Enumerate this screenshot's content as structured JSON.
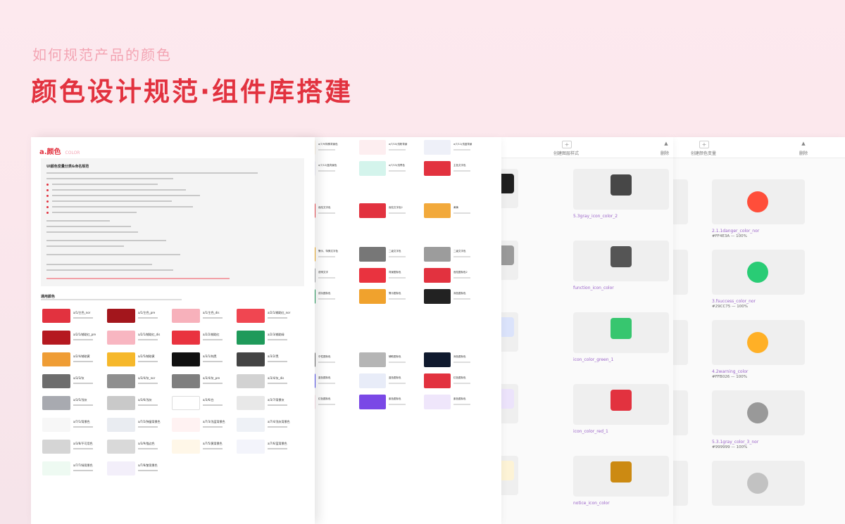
{
  "hero": {
    "subtitle": "如何规范产品的颜色",
    "title": "颜色设计规范·组件库搭建"
  },
  "doc": {
    "section_name": "a.颜色",
    "section_en": "COLOR",
    "guide_title": "UI颜色变量分类&命名规范",
    "palette_title": "通用颜色",
    "swatches": [
      {
        "label": "a/1/主色_nor",
        "sub": "primary_color_nor",
        "color": "#e2323f"
      },
      {
        "label": "a/1/主色_pre",
        "sub": "primary_color_pre",
        "color": "#a3161c"
      },
      {
        "label": "a/1/主色_dis",
        "sub": "primary_color_dis",
        "color": "#f7b1bb"
      },
      {
        "label": "a/2/1/辅助红_nor",
        "sub": "danger_color_nor",
        "color": "#f04651"
      },
      {
        "label": "a/2/1/辅助红_pre",
        "sub": "danger_color_pre",
        "color": "#b51920"
      },
      {
        "label": "a/2/1/辅助红_dis",
        "sub": "danger_color_dis",
        "color": "#f8b6c1"
      },
      {
        "label": "a/2/2/辅助红",
        "sub": "danger_color_2",
        "color": "#e9333f"
      },
      {
        "label": "a/2/3/辅助绿",
        "sub": "success_color",
        "color": "#1f9a5a"
      },
      {
        "label": "a/2/4/辅助黄",
        "sub": "warning_color",
        "color": "#ef9d35"
      },
      {
        "label": "a/2/5/辅助黄",
        "sub": "warning_color_2",
        "color": "#f6b82b"
      },
      {
        "label": "a/3/1/纯黑",
        "sub": "black_color",
        "color": "#111111"
      },
      {
        "label": "a/3/2/黑",
        "sub": "gray_color",
        "color": "#444444"
      },
      {
        "label": "a/3/3/灰",
        "sub": "gray_color_2",
        "color": "#6d6d6d"
      },
      {
        "label": "a/3/4/灰_nor",
        "sub": "gray_color_3_nor",
        "color": "#8f8f8f"
      },
      {
        "label": "a/3/4/灰_pre",
        "sub": "gray_color_3_pre",
        "color": "#7f7f7f"
      },
      {
        "label": "a/3/4/灰_dis",
        "sub": "gray_color_3_dis",
        "color": "#d2d2d2"
      },
      {
        "label": "a/3/5/浅灰",
        "sub": "gray_color_4",
        "color": "#a8aab0"
      },
      {
        "label": "a/3/6/浅灰",
        "sub": "gray_color_5",
        "color": "#c9c9c9"
      },
      {
        "label": "a/3/6/白",
        "sub": "white_color",
        "color": "#ffffff"
      },
      {
        "label": "a/3/7/背景灰",
        "sub": "line_color",
        "color": "#e8e8e8"
      },
      {
        "label": "a/7/1/背景色",
        "sub": "body_color",
        "color": "#f7f7f7"
      },
      {
        "label": "a/7/2/弹窗背景色",
        "sub": "body_color_2",
        "color": "#e9ecf1"
      },
      {
        "label": "a/7/3/浅蓝背景色",
        "sub": "body_color_3",
        "color": "#fff2f2"
      },
      {
        "label": "a/7/4/浅灰背景色",
        "sub": "body_color_4",
        "color": "#eef1f6"
      },
      {
        "label": "a/3/8/不可用色",
        "sub": "disable_color",
        "color": "#d5d5d5"
      },
      {
        "label": "a/3/9/描边色",
        "sub": "border_color",
        "color": "#d9d9d9"
      },
      {
        "label": "a/7/5/黄背景色",
        "sub": "body_color_5",
        "color": "#fff7e8"
      },
      {
        "label": "a/7/6/蓝背景色",
        "sub": "body_color_6",
        "color": "#f3f4fb"
      },
      {
        "label": "a/7/7/绿背景色",
        "sub": "body_color_7",
        "color": "#eefaf2"
      },
      {
        "label": "a/7/8/紫背景色",
        "sub": "body_color_8",
        "color": "#f3effa"
      }
    ]
  },
  "doc2": {
    "swatches": [
      {
        "label": "a/7/9/特殊背景色",
        "sub": "body_color_2",
        "color": "#fdf6e7"
      },
      {
        "label": "a/7/10/浅粉背景",
        "sub": "body_color_3",
        "color": "#fdeef0"
      },
      {
        "label": "a/7/11/浅蓝背景",
        "sub": "body_color_4",
        "color": "#eef0f8"
      },
      {
        "label": "a/7/12/蓝背景色",
        "sub": "body_color_5",
        "color": "#f1f1fb"
      },
      {
        "label": "a/7/15/浅青色",
        "sub": "bubble_color_3",
        "color": "#d4f4ec"
      },
      {
        "label": "主色文字色",
        "sub": "primary_text",
        "color": "#e2323f"
      },
      {
        "label": "危险文字色",
        "sub": "danger_text",
        "color": "#ee4a50"
      },
      {
        "label": "危险文字色2",
        "sub": "danger_text_2",
        "color": "#e2323f"
      },
      {
        "label": "黄黄",
        "sub": "warning_text",
        "color": "#f2a93b"
      },
      {
        "label": "警示、特殊文字色",
        "sub": "warning_text_2",
        "color": "#f4ae26"
      },
      {
        "label": "二级文字色",
        "sub": "gray_text",
        "color": "#777777"
      },
      {
        "label": "二级文字色",
        "sub": "gray_text_2",
        "color": "#9c9c9c"
      },
      {
        "label": "说明文字",
        "sub": "gray_text_3",
        "color": "#a6a9ae"
      },
      {
        "label": "背景图标色",
        "sub": "danger_icon",
        "color": "#e9333f"
      },
      {
        "label": "危险图标色2",
        "sub": "danger_icon_2",
        "color": "#e2323f"
      },
      {
        "label": "成功图标色",
        "sub": "success_icon",
        "color": "#1f9a5a"
      },
      {
        "label": "警示图标色",
        "sub": "warning_icon",
        "color": "#f0a22d"
      },
      {
        "label": "深色图标色",
        "sub": "black_icon",
        "color": "#222222"
      },
      {
        "label": "中性图标色",
        "sub": "gray_icon",
        "color": "#6b6b6b"
      },
      {
        "label": "辅助图标色",
        "sub": "gray_icon_2",
        "color": "#b5b5b5"
      },
      {
        "label": "深色图标色",
        "sub": "navy_icon",
        "color": "#101a2e"
      },
      {
        "label": "蓝色图标色",
        "sub": "icon_blue",
        "color": "#4f4cf0"
      },
      {
        "label": "蓝色图标色",
        "sub": "icon_blue_2",
        "color": "#e8ecf8"
      },
      {
        "label": "红色图标色",
        "sub": "icon_red",
        "color": "#e2323f"
      },
      {
        "label": "红色图标色",
        "sub": "icon_red_2",
        "color": "#fbe4ea"
      },
      {
        "label": "紫色图标色",
        "sub": "icon_purple",
        "color": "#7a48e6"
      },
      {
        "label": "紫色图标色",
        "sub": "icon_purple_2",
        "color": "#efe6fb"
      }
    ]
  },
  "style_panel": {
    "add_label": "创建图层样式",
    "delete_label": "删除",
    "items": [
      {
        "name": "5.3gray_icon_color_2",
        "color": "#474747"
      },
      {
        "name": "function_icon_color",
        "color": "#555555"
      },
      {
        "name": "icon_color_green_1",
        "color": "#37c66f"
      },
      {
        "name": "icon_color_red_1",
        "color": "#e2323f"
      },
      {
        "name": "notice_icon_color",
        "color": "#cc8a12"
      }
    ],
    "left_swatches": [
      "#1f1f1f",
      "#9a9a9a",
      "#dbe3fb",
      "#ece3fb",
      "#fdf3d6"
    ]
  },
  "var_panel": {
    "add_label": "创建颜色变量",
    "delete_label": "删除",
    "items": [
      {
        "name": "2.1.1danger_color_nor",
        "value": "#FF4E3A — 100%",
        "color": "#ff4e3a"
      },
      {
        "name": "3.fsuccess_color_nor",
        "value": "#29CC75 — 100%",
        "color": "#29cc75"
      },
      {
        "name": "4.2warning_color",
        "value": "#FFB026 — 100%",
        "color": "#ffb026"
      },
      {
        "name": "5.3.1gray_color_3_nor",
        "value": "#999999 — 100%",
        "color": "#999999"
      },
      {
        "name": "",
        "value": "",
        "color": "#c2c2c2"
      }
    ]
  }
}
